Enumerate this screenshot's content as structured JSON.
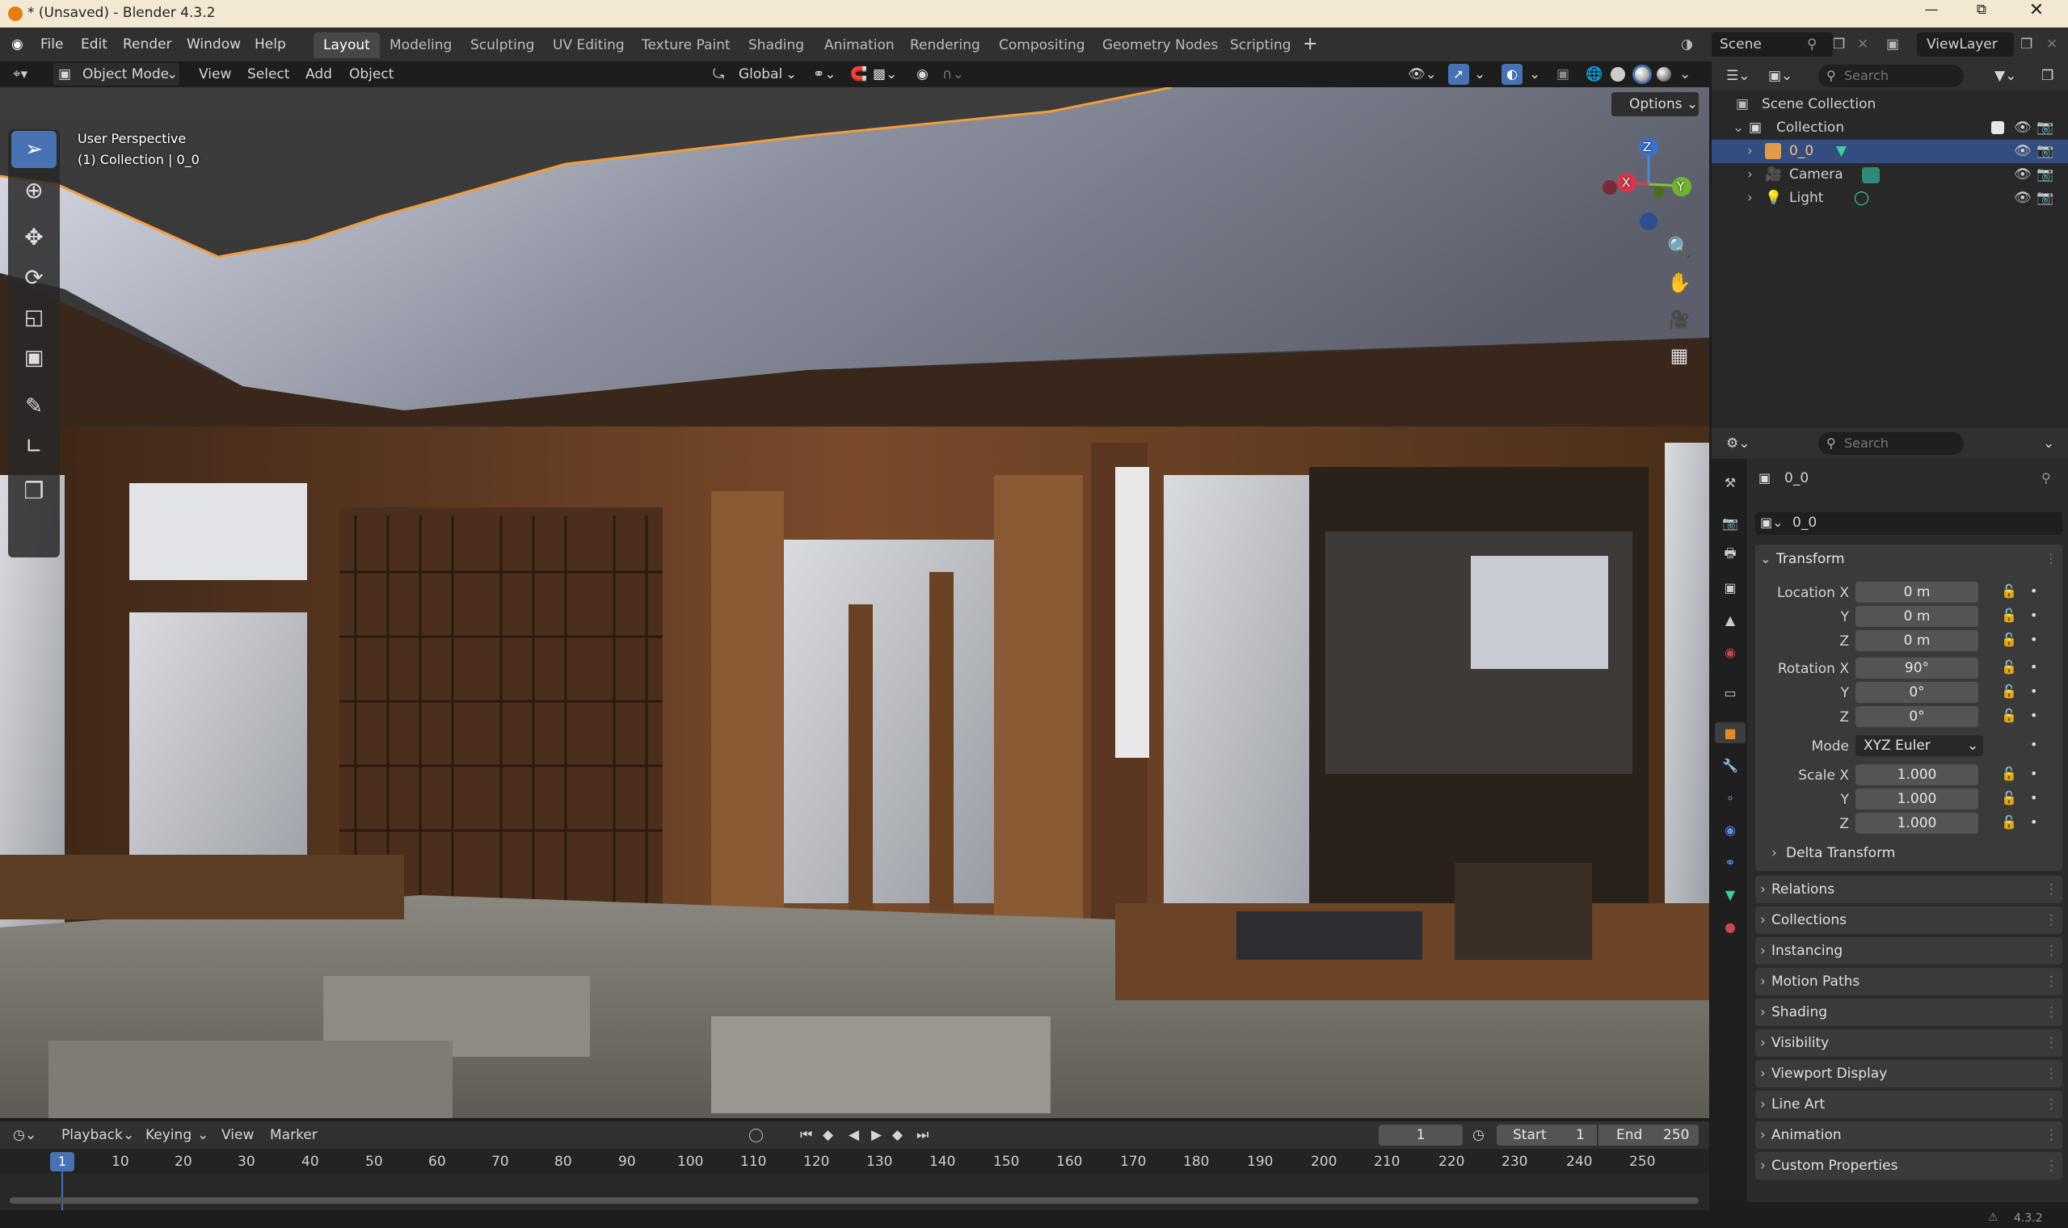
{
  "app": {
    "title": "* (Unsaved) - Blender 4.3.2"
  },
  "menu": [
    "File",
    "Edit",
    "Render",
    "Window",
    "Help"
  ],
  "workspaces": [
    "Layout",
    "Modeling",
    "Sculpting",
    "UV Editing",
    "Texture Paint",
    "Shading",
    "Animation",
    "Rendering",
    "Compositing",
    "Geometry Nodes",
    "Scripting"
  ],
  "active_workspace": "Layout",
  "scene": {
    "name": "Scene",
    "view_layer": "ViewLayer"
  },
  "viewport": {
    "mode": "Object Mode",
    "menus": [
      "View",
      "Select",
      "Add",
      "Object"
    ],
    "orientation": "Global",
    "options_label": "Options",
    "overlay_line1": "User Perspective",
    "overlay_line2": "(1) Collection | 0_0",
    "gizmo": {
      "x": "X",
      "y": "Y",
      "z": "Z"
    }
  },
  "outliner": {
    "search_placeholder": "Search",
    "scene_collection": "Scene Collection",
    "collection": "Collection",
    "items": [
      {
        "name": "0_0",
        "selected": true
      },
      {
        "name": "Camera",
        "selected": false
      },
      {
        "name": "Light",
        "selected": false
      }
    ]
  },
  "properties": {
    "search_placeholder": "Search",
    "object_name": "0_0",
    "datablock_name": "0_0",
    "transform_title": "Transform",
    "location": {
      "label_x": "Location X",
      "x": "0 m",
      "y": "0 m",
      "z": "0 m"
    },
    "rotation": {
      "label_x": "Rotation X",
      "x": "90°",
      "y": "0°",
      "z": "0°"
    },
    "mode_label": "Mode",
    "mode_value": "XYZ Euler",
    "scale": {
      "label_x": "Scale X",
      "x": "1.000",
      "y": "1.000",
      "z": "1.000"
    },
    "axis_y": "Y",
    "axis_z": "Z",
    "delta_transform": "Delta Transform",
    "sections": [
      "Relations",
      "Collections",
      "Instancing",
      "Motion Paths",
      "Shading",
      "Visibility",
      "Viewport Display",
      "Line Art",
      "Animation",
      "Custom Properties"
    ]
  },
  "timeline": {
    "menus": [
      "Playback",
      "Keying",
      "View",
      "Marker"
    ],
    "current_frame": "1",
    "start_label": "Start",
    "start": "1",
    "end_label": "End",
    "end": "250",
    "ticks": [
      "1",
      "10",
      "20",
      "30",
      "40",
      "50",
      "60",
      "70",
      "80",
      "90",
      "100",
      "110",
      "120",
      "130",
      "140",
      "150",
      "160",
      "170",
      "180",
      "190",
      "200",
      "210",
      "220",
      "230",
      "240",
      "250"
    ]
  },
  "status": {
    "version": "4.3.2"
  },
  "colors": {
    "accent": "#4772b3",
    "selection": "#334d80",
    "titlebar": "#f3e9d2",
    "orange_outline": "#f39c3c"
  }
}
